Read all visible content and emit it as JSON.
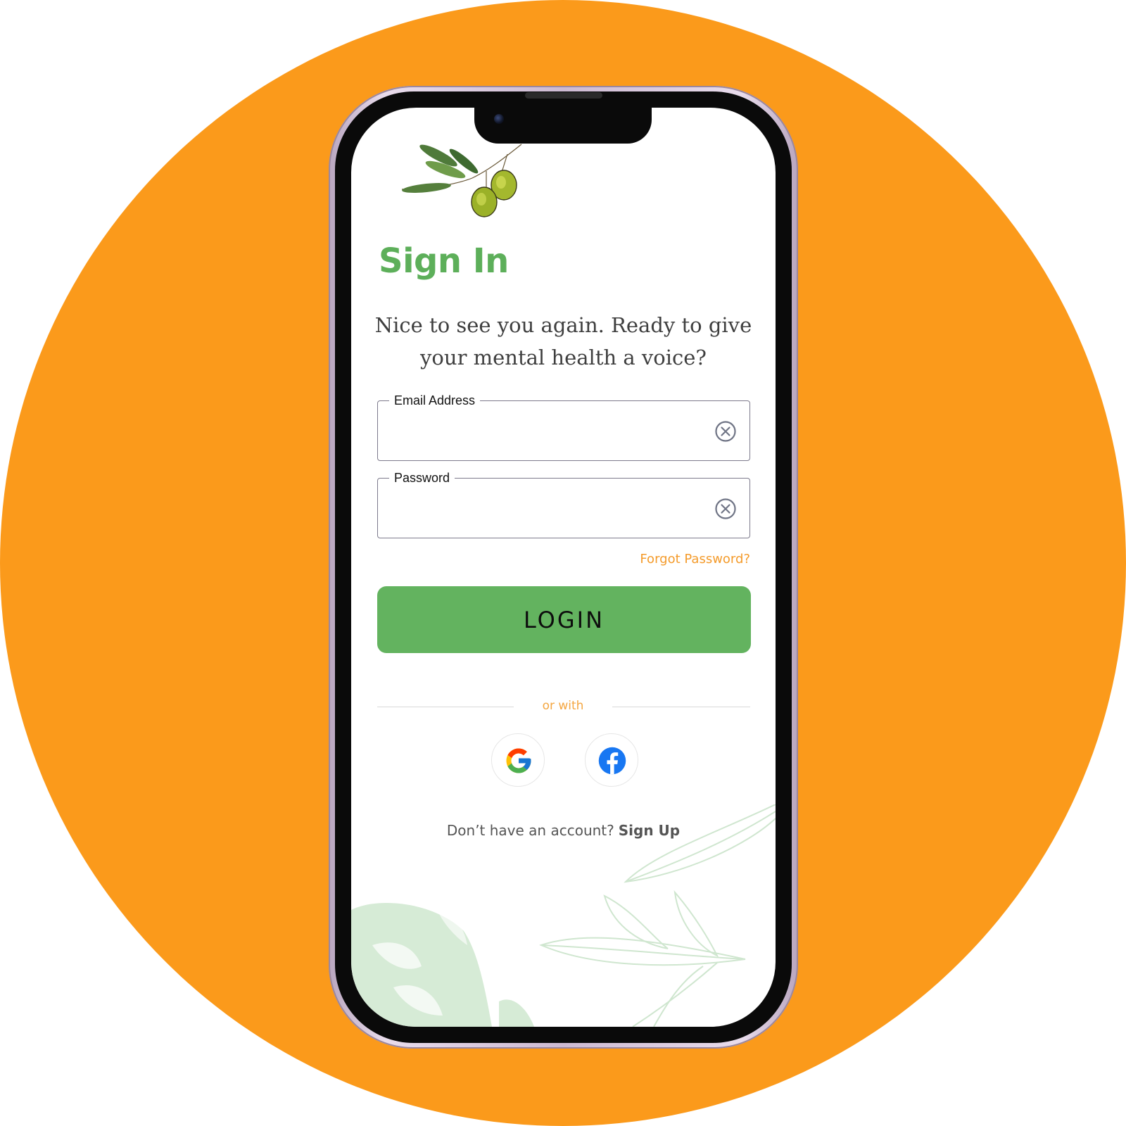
{
  "screen": {
    "title": "Sign In",
    "subtitle": "Nice to see you again. Ready to give your mental health a voice?"
  },
  "form": {
    "email_label": "Email Address",
    "email_value": "",
    "password_label": "Password",
    "password_value": "",
    "forgot_label": "Forgot Password?",
    "login_label": "LOGIN"
  },
  "social": {
    "divider_text": "or with",
    "providers": [
      "Google",
      "Facebook"
    ]
  },
  "signup": {
    "prompt": "Don’t have an account?",
    "link_label": "Sign Up"
  },
  "colors": {
    "background_circle": "#FB9A1B",
    "accent_green": "#63B35F",
    "title_green": "#5DAF5A",
    "link_orange": "#F49B2B"
  },
  "icons": [
    "olive-branch-icon",
    "clear-input-icon",
    "google-icon",
    "facebook-icon",
    "leaf-decoration"
  ]
}
